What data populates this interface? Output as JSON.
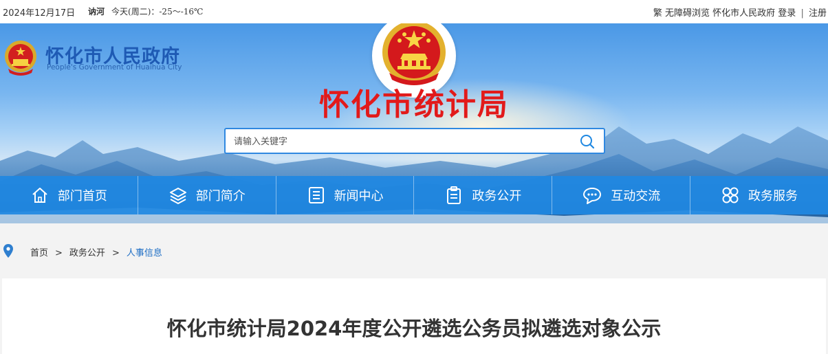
{
  "topbar": {
    "date": "2024年12月17日",
    "city": "讷河",
    "weather": "今天(周二)：-25～-16℃",
    "links": {
      "traditional": "繁",
      "accessible": "无障碍浏览",
      "gov": "怀化市人民政府",
      "login": "登录",
      "separator": "|",
      "register": "注册"
    }
  },
  "logo": {
    "name_cn": "怀化市人民政府",
    "name_en": "People's Government of Huaihua City"
  },
  "site_title": "怀化市统计局",
  "search": {
    "placeholder": "请输入关键字",
    "value": ""
  },
  "nav": [
    {
      "label": "部门首页",
      "icon": "home-icon"
    },
    {
      "label": "部门简介",
      "icon": "layers-icon"
    },
    {
      "label": "新闻中心",
      "icon": "news-icon"
    },
    {
      "label": "政务公开",
      "icon": "clipboard-icon"
    },
    {
      "label": "互动交流",
      "icon": "chat-icon"
    },
    {
      "label": "政务服务",
      "icon": "grid-icon"
    }
  ],
  "breadcrumb": {
    "home": "首页",
    "section": "政务公开",
    "current": "人事信息",
    "arrow": ">"
  },
  "article": {
    "title": "怀化市统计局2024年度公开遴选公务员拟遴选对象公示"
  },
  "colors": {
    "accent": "#1f88e2",
    "title_red": "#e21a1a",
    "breadcrumb_current": "#1f6fc5"
  }
}
